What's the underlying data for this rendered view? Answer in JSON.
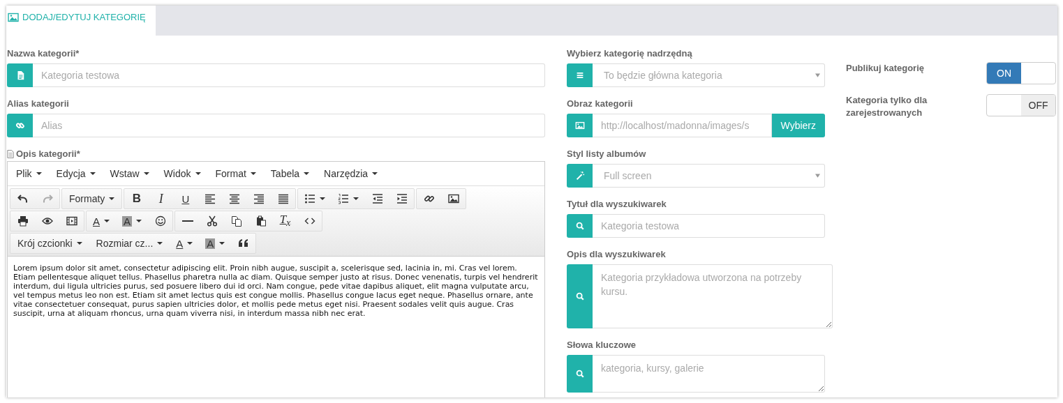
{
  "tab": {
    "label": "DODAJ/EDYTUJ KATEGORIĘ",
    "selected": true
  },
  "left_fields": [
    {
      "kind": "input",
      "label": "Nazwa kategorii*",
      "placeholder": "Kategoria testowa"
    },
    {
      "kind": "input",
      "label": "Alias kategorii",
      "placeholder": "Alias"
    }
  ],
  "editor": {
    "label": "Opis kategorii*",
    "menu": [
      "Plik",
      "Edycja",
      "Wstaw",
      "Widok",
      "Format",
      "Tabela",
      "Narzędzia"
    ],
    "toolbar_labels": [
      "Formaty",
      "B",
      "I",
      "U",
      "A",
      "A",
      "T$_{x}$",
      "Krój czcionki",
      "Rozmiar cz...",
      "A",
      "A"
    ],
    "content": "Lorem ipsum dolor sit amet, consectetur adipiscing elit. Proin nibh augue, suscipit a, scelerisque sed, lacinia in, mi. Cras vel lorem. Etiam pellentesque aliquet tellus. Phasellus pharetra nulla ac diam. Quisque semper justo at risus. Donec venenatis, turpis vel hendrerit interdum, dui ligula ultricies purus, sed posuere libero dui id orci. Nam congue, pede vitae dapibus aliquet, elit magna vulputate arcu, vel tempus metus leo non est. Etiam sit amet lectus quis est congue mollis. Phasellus congue lacus eget neque. Phasellus ornare, ante vitae consectetuer consequat, purus sapien ultricies dolor, et mollis pede metus eget nisi. Praesent sodales velit quis augue. Cras suscipit, urna at aliquam rhoncus, urna quam viverra nisi, in interdum massa nibh nec erat."
  },
  "middle_fields": [
    {
      "kind": "select",
      "label": "Wybierz kategorię nadrzędną",
      "placeholder": "To będzie główna kategoria"
    },
    {
      "kind": "file",
      "label": "Obraz kategorii",
      "placeholder": "http://localhost/madonna/images/s",
      "button": "Wybierz"
    },
    {
      "kind": "select",
      "label": "Styl listy albumów",
      "placeholder": "Full screen"
    },
    {
      "kind": "input",
      "label": "Tytuł dla wyszukiwarek",
      "placeholder": "Kategoria testowa"
    },
    {
      "kind": "textarea",
      "label": "Opis dla wyszukiwarek",
      "placeholder": "Kategoria przykładowa utworzona na potrzeby kursu."
    },
    {
      "kind": "textarea",
      "label": "Słowa kluczowe",
      "placeholder": "kategoria, kursy, galerie"
    }
  ],
  "toggles": [
    {
      "label": "Publikuj kategorię",
      "on": true,
      "text": "ON"
    },
    {
      "label": "Kategoria tylko dla zarejestrowanych",
      "on": false,
      "text": "OFF"
    }
  ]
}
